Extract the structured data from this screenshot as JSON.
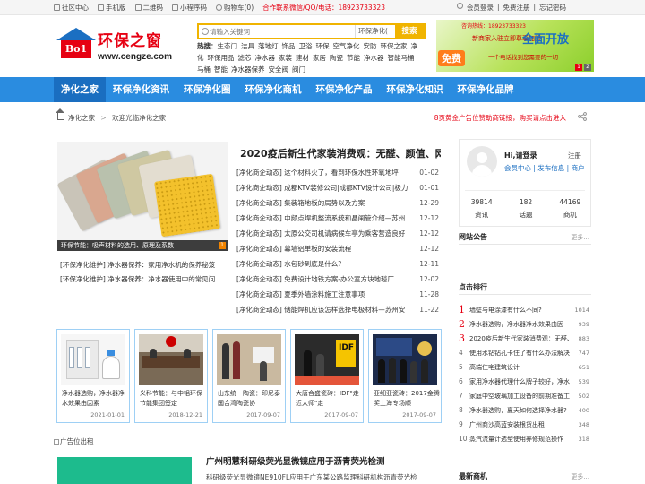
{
  "topbar": {
    "left": [
      {
        "icon": "home-icon",
        "label": "社区中心"
      },
      {
        "icon": "phone-icon",
        "label": "手机版"
      },
      {
        "icon": "qrcode-icon",
        "label": "二维码"
      },
      {
        "icon": "miniprogram-icon",
        "label": "小程序码"
      },
      {
        "icon": "cart-icon",
        "label": "购物车(0)"
      }
    ],
    "hotline": "合作联系微信/QQ/电话：18923733323",
    "right": {
      "login": "会员登录",
      "sep1": "|",
      "register": "免费注册",
      "sep2": "|",
      "forgot": "忘记密码"
    }
  },
  "logo": {
    "badge": "Bo1",
    "name": "环保之窗",
    "url": "www.cengze.com"
  },
  "search": {
    "placeholder": "请输入关键词",
    "category": "环保净化(",
    "button": "搜索"
  },
  "hotwords": {
    "label": "热搜：",
    "words": [
      "生态门",
      "洁具",
      "落地灯",
      "饰品",
      "卫浴",
      "环保",
      "空气净化",
      "安防",
      "环保之家",
      "净化",
      "环保用品",
      "滤芯",
      "净水器",
      "家装",
      "建材",
      "家居",
      "陶瓷",
      "节能",
      "净水器",
      "智能马桶",
      "马桶",
      "智能",
      "净水器保养",
      "安全阀",
      "阀门"
    ]
  },
  "banner": {
    "phone": "咨询热线：18923733323",
    "slogan1": "新商家入驻立即尊享加盟",
    "slogan2": "全面开放",
    "badge": "免费",
    "slogan3": "一个电话找到您需要的一切",
    "dots": [
      "1",
      "2"
    ]
  },
  "nav": {
    "items": [
      "净化之家",
      "环保净化资讯",
      "环保净化圈",
      "环保净化商机",
      "环保净化产品",
      "环保净化知识",
      "环保净化品牌"
    ]
  },
  "crumb": {
    "home": "净化之家",
    "arrow": ">",
    "welcome": "欢迎光临净化之家",
    "ad": "8页黄金广告位赞助商链接，购买请点击进入"
  },
  "feature": {
    "caption": "环保节能：吸声材料的选用、原理及系数",
    "num": "1"
  },
  "leftlist": [
    "[环保净化维护] 净水器保养：家用净水机的保养秘笈",
    "[环保净化维护] 净水器保养：净水器使用中的常见问"
  ],
  "headline": "2020疫后新生代家装消费观：无醛、颜值、网",
  "news": [
    {
      "title": "[净化商企动态] 这个材料火了，看到环保水性环氧地坪",
      "date": "01-02"
    },
    {
      "title": "[净化商企动态] 成都KTV装修公司|成都KTV设计公司|极力",
      "date": "01-01"
    },
    {
      "title": "[净化商企动态] 集装箱地板的局势以及方案",
      "date": "12-29"
    },
    {
      "title": "[净化商企动态] 中频点焊机整流系统和晶闸管介绍—苏州",
      "date": "12-12"
    },
    {
      "title": "[净化商企动态] 太原公交司机请病候车亭为乘客营造良好",
      "date": "12-12"
    },
    {
      "title": "[净化商企动态] 幕墙铝单板的安装流程",
      "date": "12-12"
    },
    {
      "title": "[净化商企动态] 水包砂到底是什么?",
      "date": "12-11"
    },
    {
      "title": "[净化商企动态] 免费设计地铁方案-办公室方块地毯厂",
      "date": "12-02"
    },
    {
      "title": "[净化商企动态] 夏季外墙涂料施工注意事项",
      "date": "11-28"
    },
    {
      "title": "[净化商企动态] 储能焊机应该怎样选择电极材料—苏州安",
      "date": "11-22"
    }
  ],
  "cards": [
    {
      "title": "净水器选购，净水器净水效果由因素",
      "date": "2021-01-01"
    },
    {
      "title": "义科节能：与中铝环保节能集团签定",
      "date": "2018-12-21"
    },
    {
      "title": "山东统一陶瓷：印尼泰国合湾陶瓷协",
      "date": "2017-09-07"
    },
    {
      "title": "大唐合盛瓷砖：IDF\"走近大师\"走",
      "date": "2017-09-07"
    },
    {
      "title": "亚细亚瓷砖：2017金腾奖上海专场顺",
      "date": "2017-09-07"
    }
  ],
  "adslot": "广告位出租",
  "bottom": {
    "title": "广州明慧科研级荧光显微镜应用于沥青荧光检测",
    "sub": "科研级荧光显微镜NE910FL应用于广东某公路监理科研机构沥青荧光检"
  },
  "user": {
    "greeting": "Hi,请登录",
    "register": "注册",
    "links": "会员中心 | 发布信息 | 商户",
    "stats": [
      {
        "value": "39814",
        "label": "资讯"
      },
      {
        "value": "182",
        "label": "话题"
      },
      {
        "value": "44169",
        "label": "商机"
      }
    ]
  },
  "notice": {
    "title": "网站公告",
    "more": "更多..."
  },
  "ranking": {
    "title": "点击排行",
    "more": "更多...",
    "items": [
      {
        "n": "1",
        "title": "墙壁与电涂漆有什么不同?",
        "count": "1014"
      },
      {
        "n": "2",
        "title": "净水器选购，净水器净水效果由因",
        "count": "939"
      },
      {
        "n": "3",
        "title": "2020疫后新生代家装消费观：无醛、",
        "count": "883"
      },
      {
        "n": "4",
        "title": "使用水钻钻孔卡住了有什么办法解决",
        "count": "747"
      },
      {
        "n": "5",
        "title": "高端住宅建筑设计",
        "count": "651"
      },
      {
        "n": "6",
        "title": "家用净水器代理什么牌子较好，净水",
        "count": "539"
      },
      {
        "n": "7",
        "title": "家庭中空玻璃加工设备的前期准备工",
        "count": "502"
      },
      {
        "n": "8",
        "title": "净水器选购，夏天如何选择净水器?",
        "count": "400"
      },
      {
        "n": "9",
        "title": "广州商沙高蓝安装根货出租",
        "count": "348"
      },
      {
        "n": "10",
        "title": "蒸汽流量计选型使用养修规范操作",
        "count": "318"
      }
    ]
  },
  "latest": {
    "title": "最新商机",
    "more": "更多..."
  },
  "colors": {
    "nav": "#2a8ce0",
    "navActive": "#1a6ec0",
    "accent": "#e60012",
    "search": "#f0b400"
  }
}
